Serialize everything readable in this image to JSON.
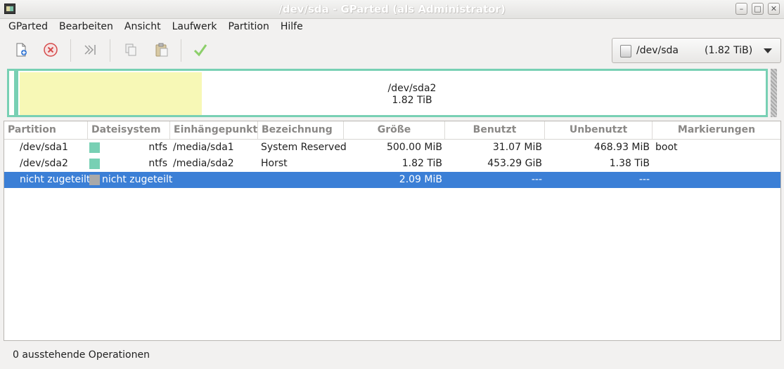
{
  "window": {
    "title": "/dev/sda - GParted (als Administrator)"
  },
  "menubar": {
    "items": [
      "GParted",
      "Bearbeiten",
      "Ansicht",
      "Laufwerk",
      "Partition",
      "Hilfe"
    ]
  },
  "toolbar": {
    "buttons": [
      "new-icon",
      "delete-icon",
      "resize-move-icon",
      "copy-icon",
      "paste-icon",
      "apply-icon"
    ],
    "device": {
      "name": "/dev/sda",
      "size": "(1.82 TiB)"
    }
  },
  "disk_visual": {
    "label_name": "/dev/sda2",
    "label_size": "1.82 TiB",
    "colors": {
      "ntfs": "#78d0b4",
      "used": "#f7f8b6",
      "unallocated": "#a9a9a9"
    }
  },
  "table": {
    "headers": [
      "Partition",
      "Dateisystem",
      "Einhängepunkt",
      "Bezeichnung",
      "Größe",
      "Benutzt",
      "Unbenutzt",
      "Markierungen"
    ],
    "rows": [
      {
        "partition": "/dev/sda1",
        "fs_color": "#78d0b4",
        "filesystem": "ntfs",
        "mountpoint": "/media/sda1",
        "label": "System Reserved",
        "size": "500.00 MiB",
        "used": "31.07 MiB",
        "unused": "468.93 MiB",
        "flags": "boot"
      },
      {
        "partition": "/dev/sda2",
        "fs_color": "#78d0b4",
        "filesystem": "ntfs",
        "mountpoint": "/media/sda2",
        "label": "Horst",
        "size": "1.82 TiB",
        "used": "453.29 GiB",
        "unused": "1.38 TiB",
        "flags": ""
      },
      {
        "partition": "nicht zugeteilt",
        "fs_color": "#a9a9a9",
        "filesystem": "nicht zugeteilt",
        "mountpoint": "",
        "label": "",
        "size": "2.09 MiB",
        "used": "---",
        "unused": "---",
        "flags": ""
      }
    ]
  },
  "statusbar": {
    "text": "0 ausstehende Operationen"
  }
}
